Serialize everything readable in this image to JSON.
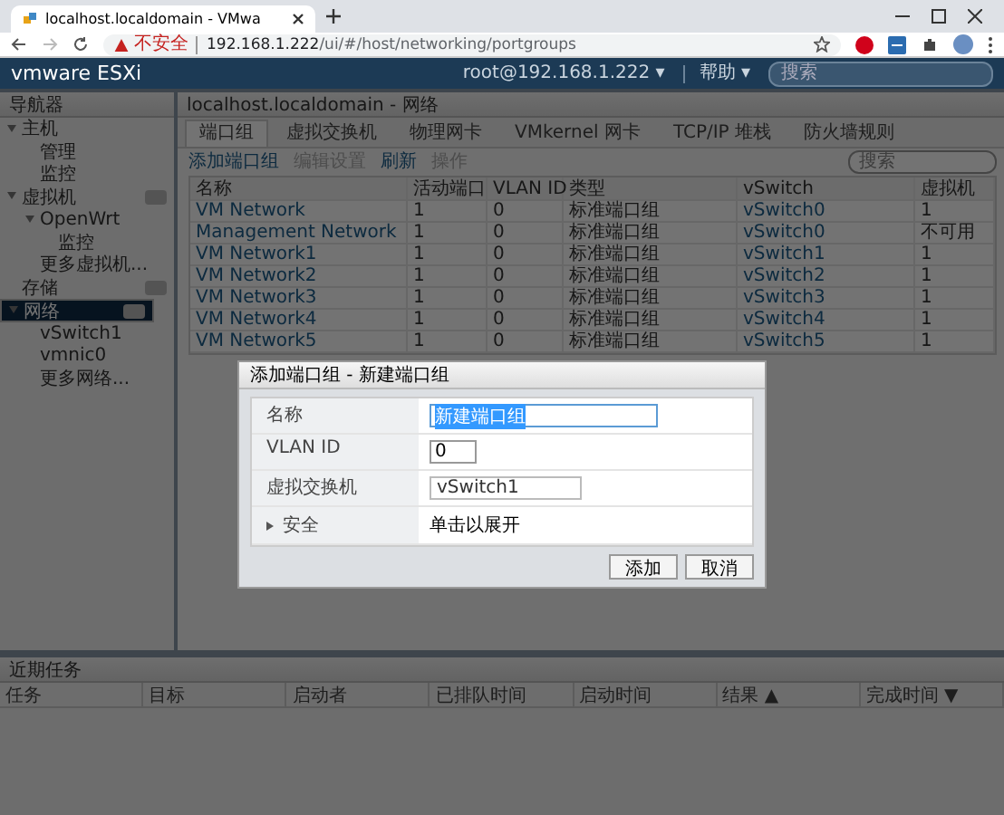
{
  "browser": {
    "tab_title": "localhost.localdomain - VMwa",
    "security": "不安全",
    "url_host": "192.168.1.222",
    "url_path": "/ui/#/host/networking/portgroups"
  },
  "header": {
    "logo": "vmware ESXi",
    "user": "root@192.168.1.222 ▾",
    "help": "帮助 ▾",
    "search_placeholder": "搜索"
  },
  "navigator": {
    "title": "导航器",
    "items": [
      {
        "label": "主机",
        "selected": false,
        "has_badge": false,
        "children": [
          {
            "label": "管理",
            "selected": false,
            "has_badge": false
          },
          {
            "label": "监控",
            "selected": false,
            "has_badge": false
          }
        ]
      },
      {
        "label": "虚拟机",
        "selected": false,
        "has_badge": true,
        "children": [
          {
            "label": "OpenWrt",
            "selected": false,
            "has_badge": false,
            "children": [
              {
                "label": "监控",
                "selected": false,
                "has_badge": false
              }
            ]
          },
          {
            "label": "更多虚拟机...",
            "selected": false,
            "has_badge": false
          }
        ]
      },
      {
        "label": "存储",
        "selected": false,
        "has_badge": true
      },
      {
        "label": "网络",
        "selected": true,
        "has_badge": true,
        "children": [
          {
            "label": "vSwitch1",
            "selected": false,
            "has_badge": false
          },
          {
            "label": "vmnic0",
            "selected": false,
            "has_badge": false
          },
          {
            "label": "更多网络...",
            "selected": false,
            "has_badge": false
          }
        ]
      }
    ]
  },
  "panel": {
    "title": "localhost.localdomain - 网络",
    "tabs": [
      {
        "label": "端口组",
        "selected": true
      },
      {
        "label": "虚拟交换机",
        "selected": false
      },
      {
        "label": "物理网卡",
        "selected": false
      },
      {
        "label": "VMkernel 网卡",
        "selected": false
      },
      {
        "label": "TCP/IP 堆栈",
        "selected": false
      },
      {
        "label": "防火墙规则",
        "selected": false
      }
    ],
    "toolbar": [
      {
        "label": "添加端口组",
        "disabled": false
      },
      {
        "label": "编辑设置",
        "disabled": true
      },
      {
        "label": "刷新",
        "disabled": false
      },
      {
        "label": "操作",
        "disabled": true
      }
    ],
    "search_placeholder": "搜索",
    "columns": [
      "名称",
      "活动端口",
      "VLAN ID",
      "类型",
      "vSwitch",
      "虚拟机"
    ],
    "rows": [
      [
        "VM Network",
        "1",
        "0",
        "标准端口组",
        "vSwitch0",
        "1"
      ],
      [
        "Management Network",
        "1",
        "0",
        "标准端口组",
        "vSwitch0",
        "不可用"
      ],
      [
        "VM Network1",
        "1",
        "0",
        "标准端口组",
        "vSwitch1",
        "1"
      ],
      [
        "VM Network2",
        "1",
        "0",
        "标准端口组",
        "vSwitch2",
        "1"
      ],
      [
        "VM Network3",
        "1",
        "0",
        "标准端口组",
        "vSwitch3",
        "1"
      ],
      [
        "VM Network4",
        "1",
        "0",
        "标准端口组",
        "vSwitch4",
        "1"
      ],
      [
        "VM Network5",
        "1",
        "0",
        "标准端口组",
        "vSwitch5",
        "1"
      ]
    ]
  },
  "tasks": {
    "title": "近期任务",
    "columns": [
      {
        "label": "任务"
      },
      {
        "label": "目标"
      },
      {
        "label": "启动者"
      },
      {
        "label": "已排队时间"
      },
      {
        "label": "启动时间"
      },
      {
        "label": "结果",
        "sort": "▲"
      },
      {
        "label": "完成时间",
        "sort": "▼"
      }
    ]
  },
  "dialog": {
    "title": "添加端口组 - 新建端口组",
    "name_label": "名称",
    "name_value": "新建端口组",
    "vlan_label": "VLAN ID",
    "vlan_value": "0",
    "switch_label": "虚拟交换机",
    "switch_value": "vSwitch1",
    "security_label": "安全",
    "security_value": "单击以展开",
    "buttons": [
      "添加",
      "取消"
    ]
  }
}
